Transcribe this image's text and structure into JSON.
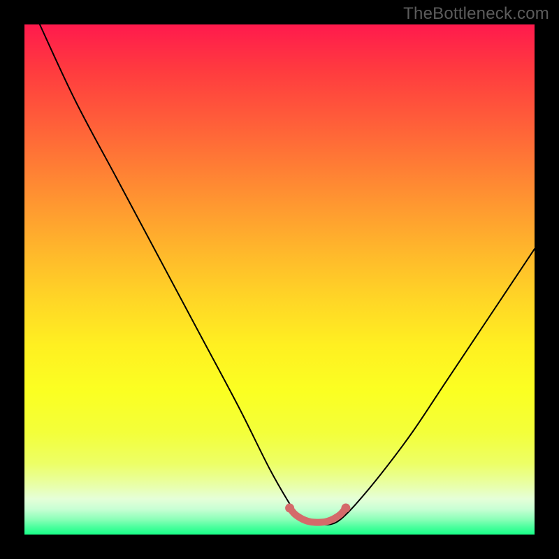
{
  "watermark": "TheBottleneck.com",
  "chart_data": {
    "type": "line",
    "title": "",
    "xlabel": "",
    "ylabel": "",
    "xlim": [
      0,
      100
    ],
    "ylim": [
      0,
      100
    ],
    "grid": false,
    "legend": false,
    "series": [
      {
        "name": "bottleneck-curve",
        "color": "#000000",
        "x": [
          3,
          10,
          18,
          26,
          34,
          42,
          48,
          52,
          54,
          56,
          58,
          60,
          62,
          65,
          70,
          76,
          82,
          88,
          94,
          100
        ],
        "values": [
          100,
          85,
          70,
          55,
          40,
          25,
          13,
          6,
          3,
          2,
          2,
          2,
          3,
          6,
          12,
          20,
          29,
          38,
          47,
          56
        ]
      }
    ],
    "highlight": {
      "name": "flat-minimum",
      "color": "#d46a6a",
      "x": [
        52,
        53,
        54,
        55,
        56,
        57,
        58,
        59,
        60,
        61,
        62,
        63
      ],
      "values": [
        5.2,
        4.0,
        3.3,
        2.8,
        2.5,
        2.4,
        2.4,
        2.5,
        2.8,
        3.3,
        4.0,
        5.2
      ]
    }
  }
}
